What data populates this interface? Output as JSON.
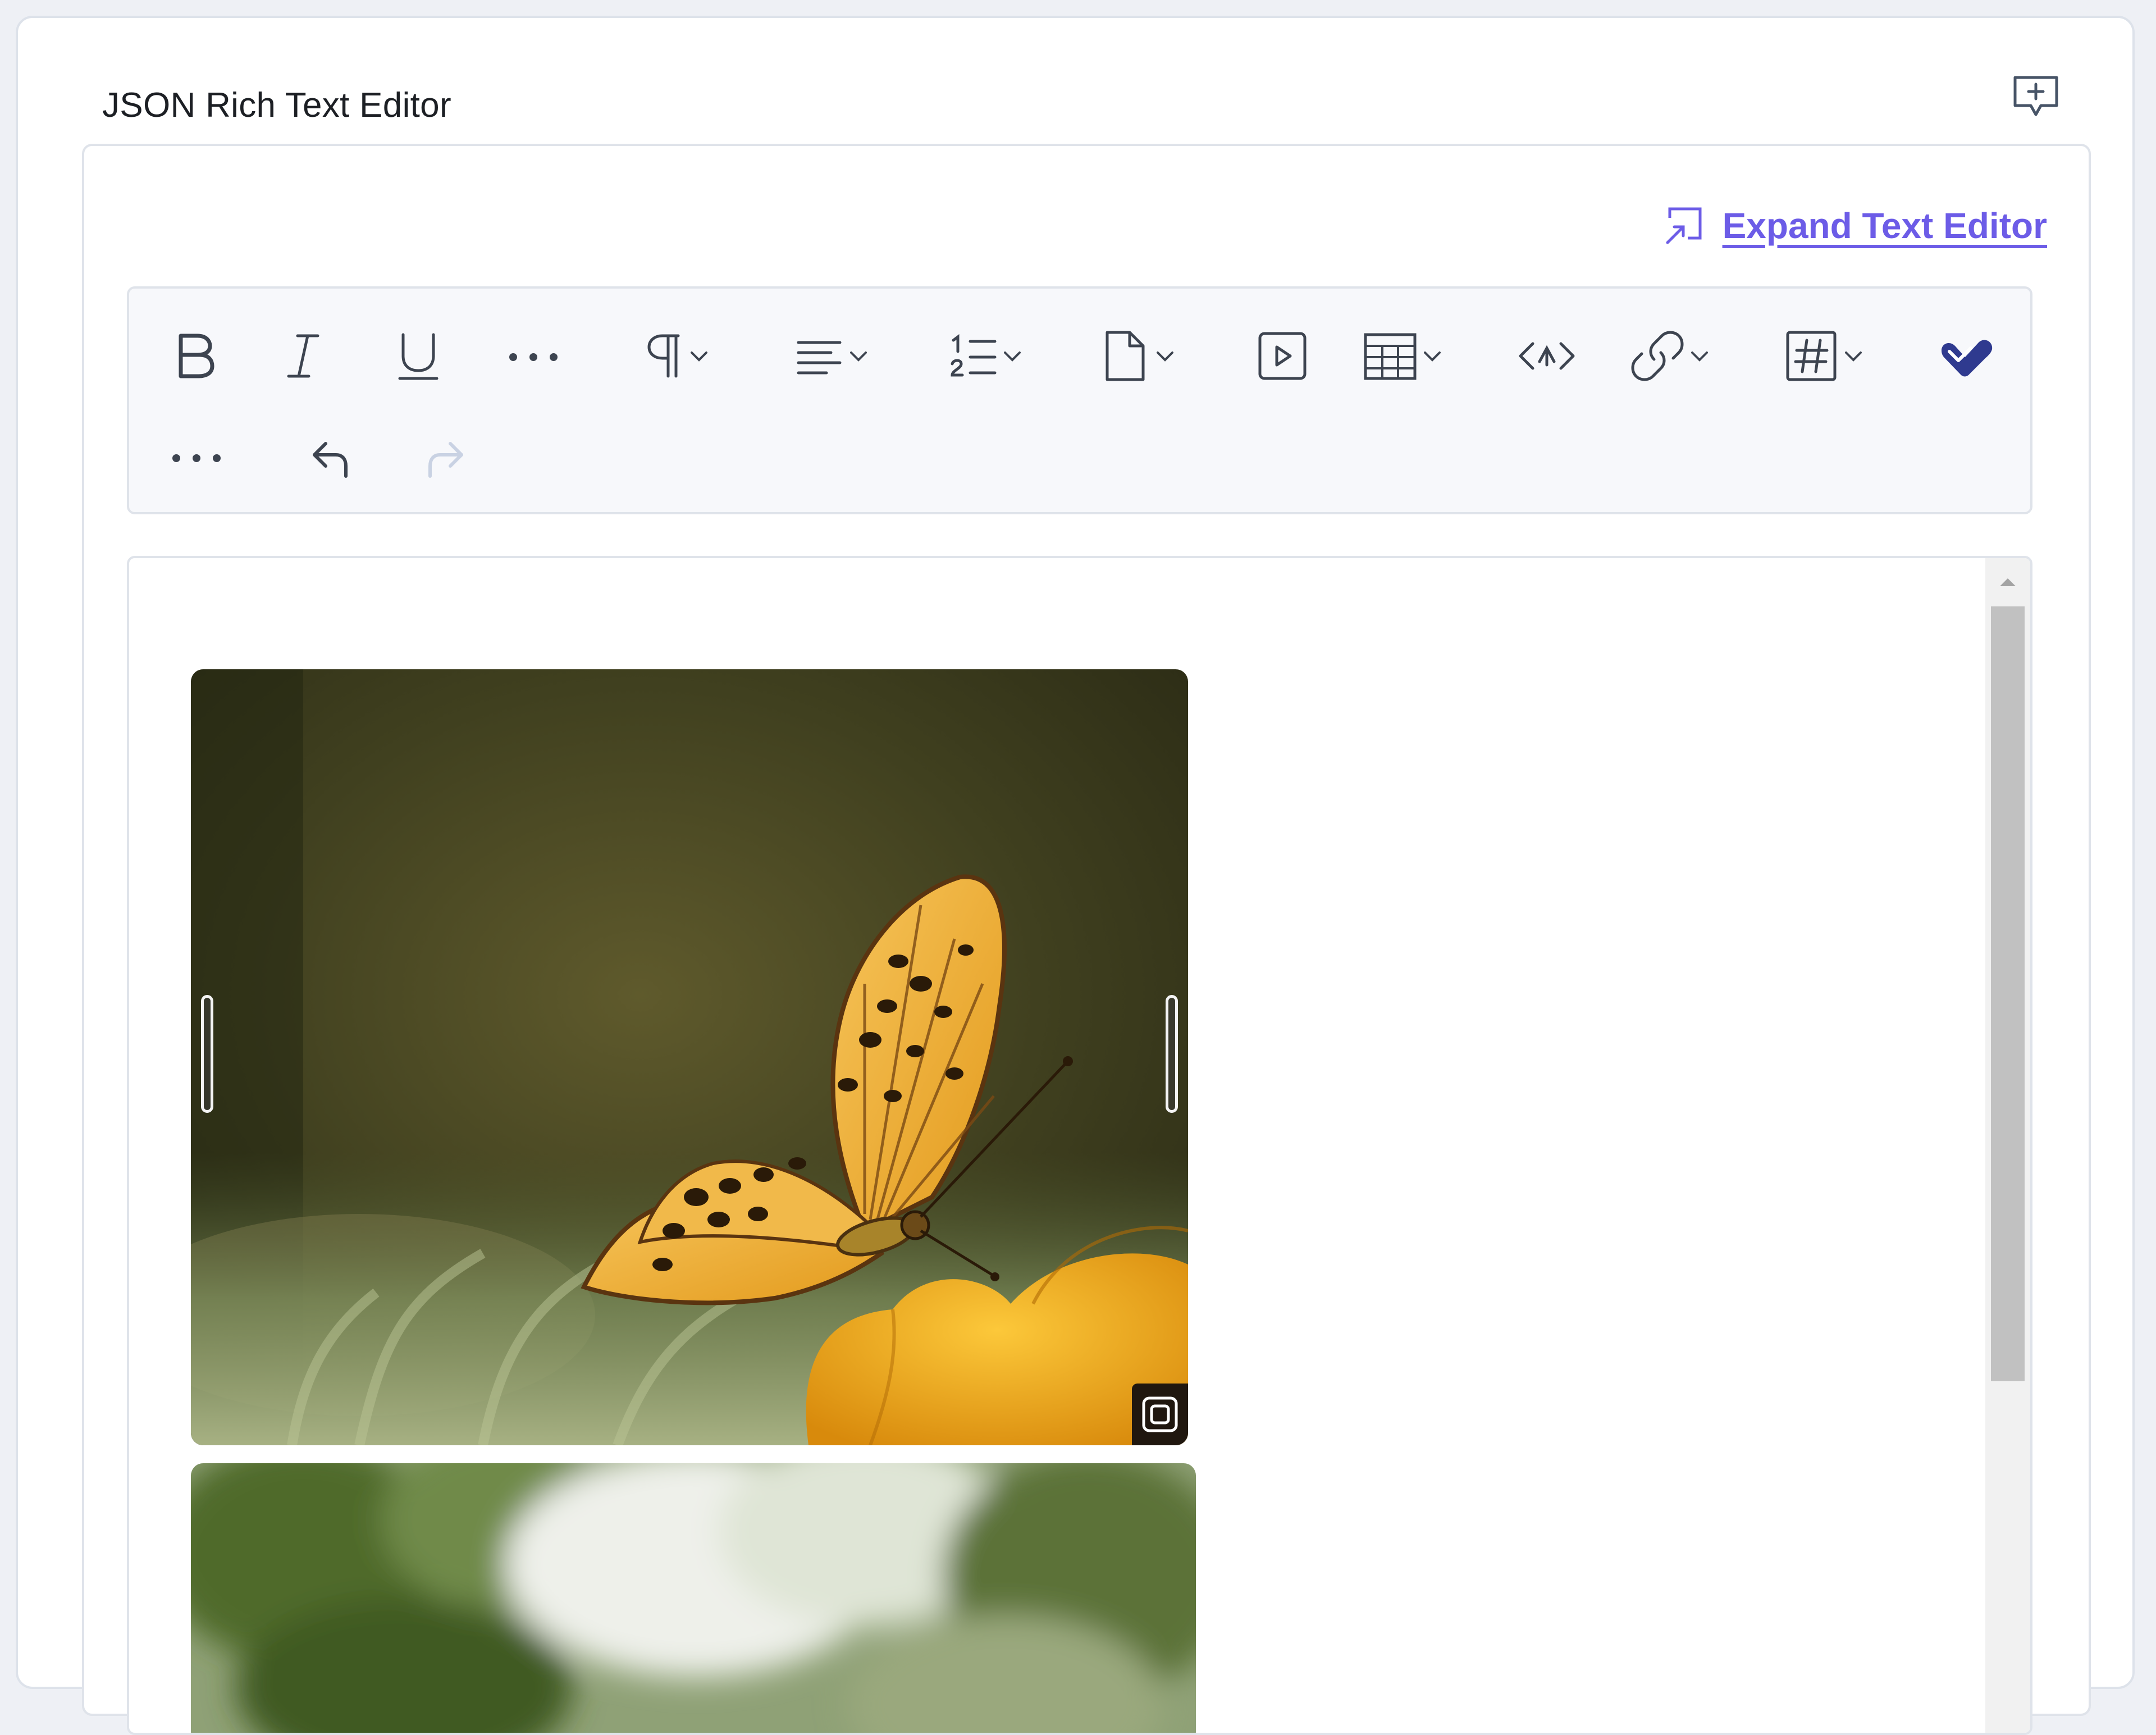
{
  "field": {
    "title": "JSON Rich Text Editor",
    "comment_icon": "comment-add-icon"
  },
  "editor": {
    "expand_label": "Expand Text Editor",
    "expand_icon": "expand-icon",
    "accent_color": "#6c5ce7"
  },
  "toolbar": {
    "row1": [
      {
        "name": "bold",
        "icon": "bold-icon"
      },
      {
        "name": "italic",
        "icon": "italic-icon"
      },
      {
        "name": "underline",
        "icon": "underline-icon"
      },
      {
        "name": "more-formatting",
        "icon": "more-horizontal-icon"
      },
      {
        "name": "paragraph",
        "icon": "paragraph-icon",
        "dropdown": true
      },
      {
        "name": "align",
        "icon": "align-left-icon",
        "dropdown": true
      },
      {
        "name": "list",
        "icon": "ordered-list-icon",
        "dropdown": true
      },
      {
        "name": "asset",
        "icon": "file-icon",
        "dropdown": true
      },
      {
        "name": "video",
        "icon": "video-icon"
      },
      {
        "name": "table",
        "icon": "table-icon",
        "dropdown": true
      },
      {
        "name": "embed",
        "icon": "code-embed-icon"
      },
      {
        "name": "link",
        "icon": "link-icon",
        "dropdown": true
      },
      {
        "name": "reference",
        "icon": "hashtag-icon",
        "dropdown": true
      },
      {
        "name": "plugin",
        "icon": "brand-check-icon"
      }
    ],
    "row2": [
      {
        "name": "more",
        "icon": "more-horizontal-icon"
      },
      {
        "name": "undo",
        "icon": "undo-icon"
      },
      {
        "name": "redo",
        "icon": "redo-icon",
        "disabled": true
      }
    ]
  },
  "content": {
    "images": [
      {
        "subject": "butterfly-on-yellow-flower",
        "badge_icon": "image-options-icon"
      },
      {
        "subject": "blurred-green-foliage"
      }
    ]
  }
}
